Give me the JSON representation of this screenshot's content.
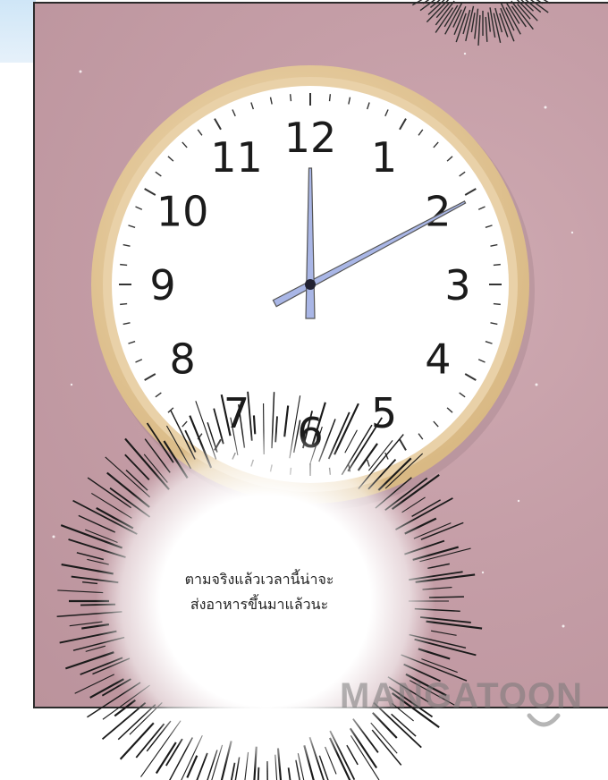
{
  "clock": {
    "numerals": [
      "12",
      "1",
      "2",
      "3",
      "4",
      "5",
      "6",
      "7",
      "8",
      "9",
      "10",
      "11"
    ],
    "time_shown": {
      "hour": 12,
      "minute": 10
    },
    "colors": {
      "frame": "#e6c99a",
      "face": "#ffffff",
      "hands": "#a9b6e6",
      "numerals": "#1b1b1b",
      "wall": "#c49ea7"
    }
  },
  "speech_bubble": {
    "line1": "ตามจริงแล้วเวลานี้น่าจะ",
    "line2": "ส่งอาหารขึ้นมาแล้วนะ"
  },
  "watermark": {
    "text": "MANGATOON"
  }
}
